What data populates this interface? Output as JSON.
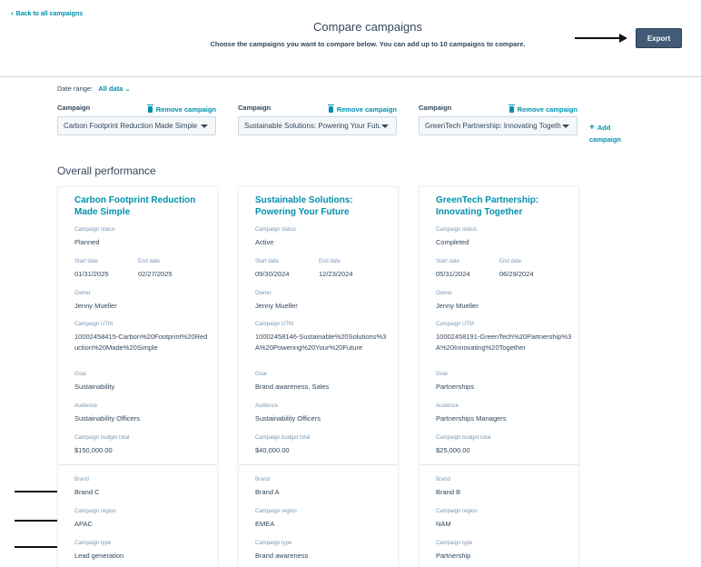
{
  "header": {
    "back_label": "Back to all campaigns",
    "title": "Compare campaigns",
    "subtitle": "Choose the campaigns you want to compare below. You can add up to 10 campaigns to compare.",
    "export_label": "Export"
  },
  "filters": {
    "date_range_label": "Date range:",
    "date_range_value": "All data",
    "campaign_label": "Campaign",
    "remove_label": "Remove campaign",
    "add_label_line1": "Add",
    "add_label_line2": "campaign",
    "selected": [
      "Carbon Footprint Reduction Made Simple",
      "Sustainable Solutions: Powering Your Future",
      "GreenTech Partnership: Innovating Together"
    ]
  },
  "section_title": "Overall performance",
  "labels": {
    "status": "Campaign status",
    "start": "Start date",
    "end": "End date",
    "owner": "Owner",
    "utm": "Campaign UTM",
    "goal": "Goal",
    "audience": "Audience",
    "budget": "Campaign budget total",
    "brand": "Brand",
    "region": "Campaign region",
    "type": "Campaign type"
  },
  "campaigns": [
    {
      "name": "Carbon Footprint Reduction Made Simple",
      "status": "Planned",
      "start": "01/31/2025",
      "end": "02/27/2025",
      "owner": "Jenny Mueller",
      "utm": "10002458415-Carbon%20Footprint%20Reduction%20Made%20Simple",
      "goal": "Sustainability",
      "audience": "Sustainability Officers",
      "budget": "$150,000.00",
      "brand": "Brand C",
      "region": "APAC",
      "type": "Lead generation"
    },
    {
      "name": "Sustainable Solutions: Powering Your Future",
      "status": "Active",
      "start": "09/30/2024",
      "end": "12/23/2024",
      "owner": "Jenny Mueller",
      "utm": "10002458146-Sustainable%20Solutions%3A%20Powering%20Your%20Future",
      "goal": "Brand awareness, Sales",
      "audience": "Sustainability Officers",
      "budget": "$40,000.00",
      "brand": "Brand A",
      "region": "EMEA",
      "type": "Brand awareness"
    },
    {
      "name": "GreenTech Partnership: Innovating Together",
      "status": "Completed",
      "start": "05/31/2024",
      "end": "06/29/2024",
      "owner": "Jenny Mueller",
      "utm": "10002458191-GreenTech%20Partnership%3A%20Innovating%20Together",
      "goal": "Partnerships",
      "audience": "Partnerships Managers",
      "budget": "$25,000.00",
      "brand": "Brand B",
      "region": "NAM",
      "type": "Partnership"
    }
  ]
}
